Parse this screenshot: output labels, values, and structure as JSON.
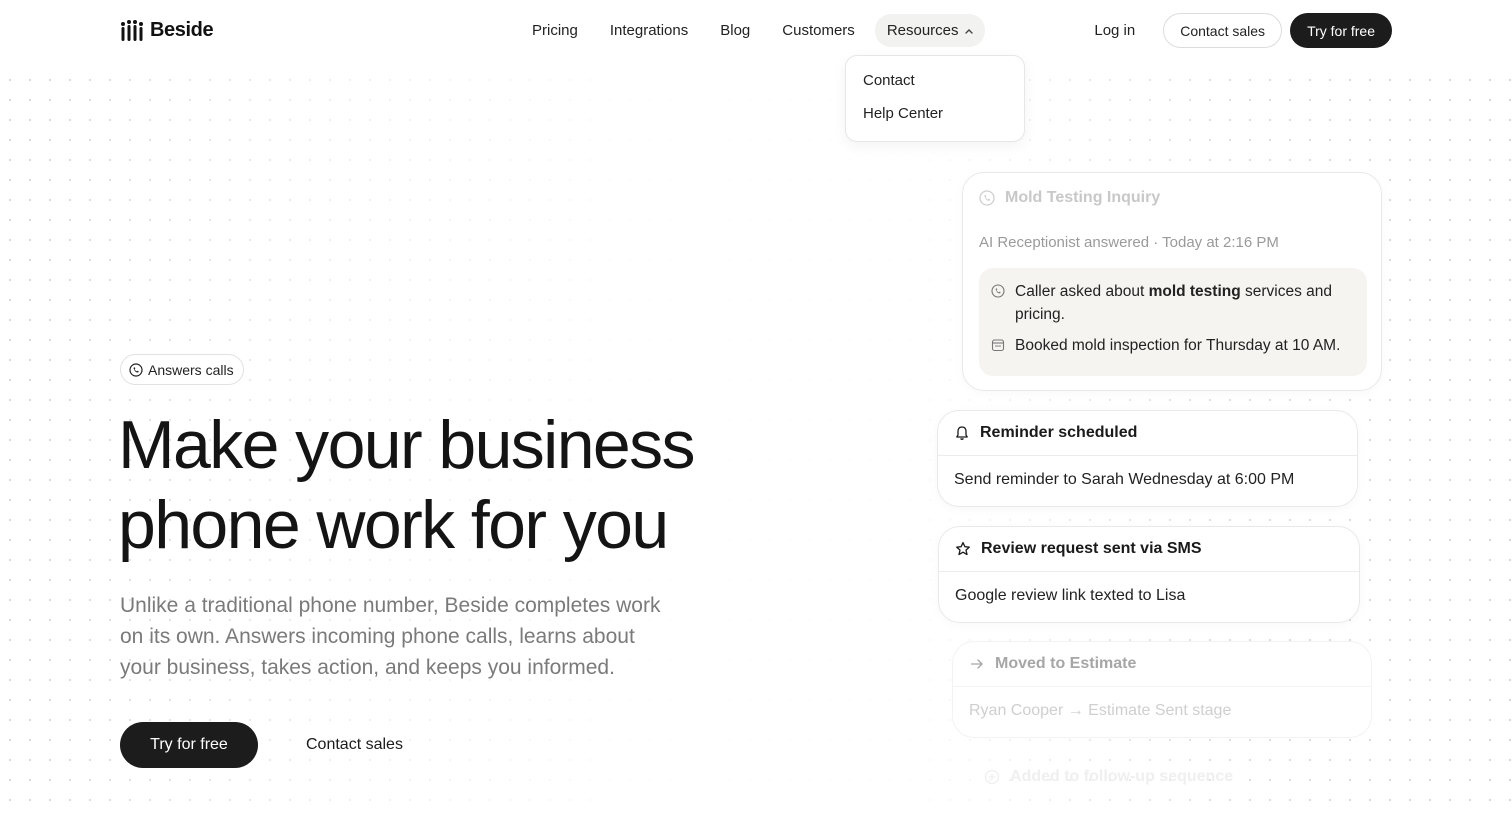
{
  "brand": {
    "name": "Beside"
  },
  "nav": {
    "links": [
      "Pricing",
      "Integrations",
      "Blog",
      "Customers"
    ],
    "resources_label": "Resources",
    "login_label": "Log in",
    "contact_sales_label": "Contact sales",
    "try_free_label": "Try for free"
  },
  "resources_menu": {
    "items": [
      "Contact",
      "Help Center"
    ]
  },
  "hero": {
    "badge": "Answers calls",
    "title_line1": "Make your business",
    "title_line2": "phone work for you",
    "subtitle": "Unlike a traditional phone number, Beside completes work on its own. Answers incoming phone calls, learns about your business, takes action, and keeps you informed.",
    "cta_primary": "Try for free",
    "cta_secondary": "Contact sales"
  },
  "call_card": {
    "title": "Mold Testing Inquiry",
    "meta": "AI Receptionist answered · Today at 2:16 PM",
    "summary_1_before": "Caller asked about ",
    "summary_1_bold": "mold testing",
    "summary_1_after": " services and pricing.",
    "summary_2": "Booked mold inspection for Thursday at 10 AM."
  },
  "reminder_card": {
    "title": "Reminder scheduled",
    "body": "Send reminder to Sarah Wednesday at 6:00 PM"
  },
  "review_card": {
    "title": "Review request sent via SMS",
    "body": "Google review link texted to Lisa"
  },
  "moved_card": {
    "title": "Moved to Estimate",
    "body": "Ryan Cooper → Estimate Sent stage"
  },
  "ghost_card": {
    "title": "Added to follow-up sequence"
  },
  "colors": {
    "primary_dark": "#1c1c1c",
    "muted_text": "#7a7a7a",
    "summary_bg": "#f5f4f0"
  }
}
